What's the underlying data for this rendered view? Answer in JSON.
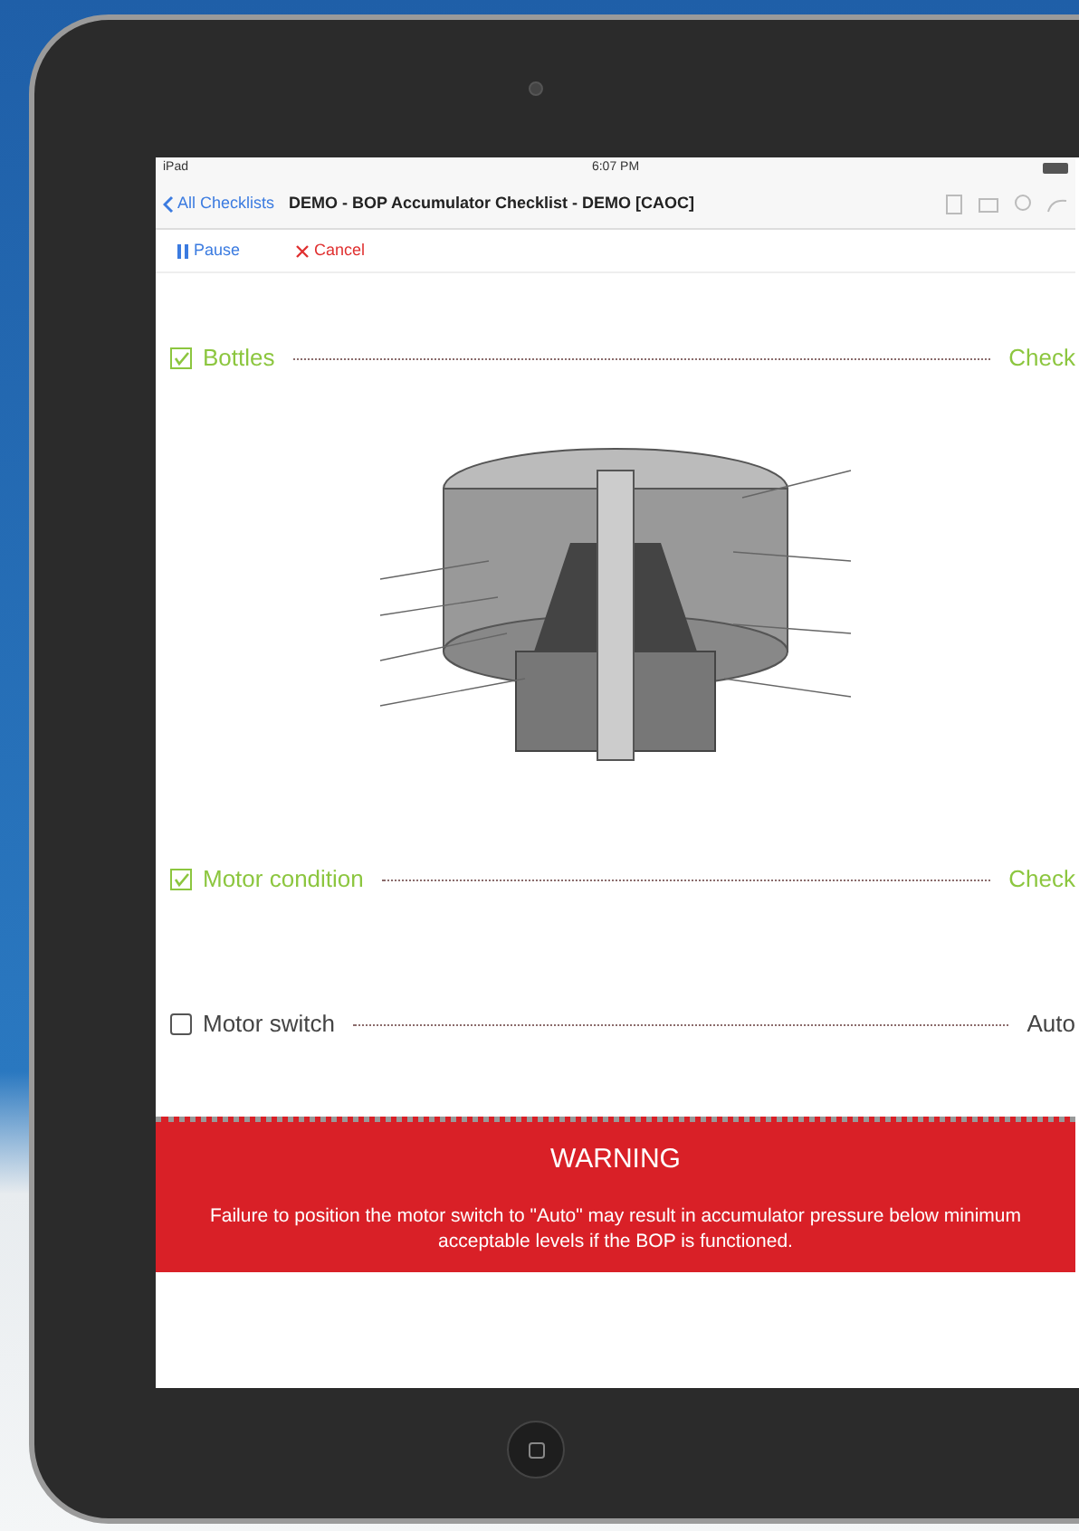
{
  "status_bar": {
    "carrier": "iPad",
    "time": "6:07 PM"
  },
  "nav_bar": {
    "back": "All Checklists",
    "title": "DEMO - BOP Accumulator Checklist - DEMO [CAOC]"
  },
  "toolbar": {
    "buttons": [
      {
        "label": "Pause",
        "kind": "pause"
      },
      {
        "label": "Cancel",
        "kind": "cancel"
      }
    ]
  },
  "checklist": [
    {
      "kind": "item",
      "label": "Bottles",
      "value": "Check",
      "checked": true
    },
    {
      "kind": "diagram"
    },
    {
      "kind": "item",
      "label": "Motor condition",
      "value": "Check",
      "checked": true
    },
    {
      "kind": "item",
      "label": "Motor switch",
      "value": "Auto",
      "checked": false
    }
  ],
  "warning": {
    "title": "WARNING",
    "text": "Failure to position the motor switch to \"Auto\" may result in accumulator pressure below minimum acceptable levels if the BOP is functioned."
  }
}
